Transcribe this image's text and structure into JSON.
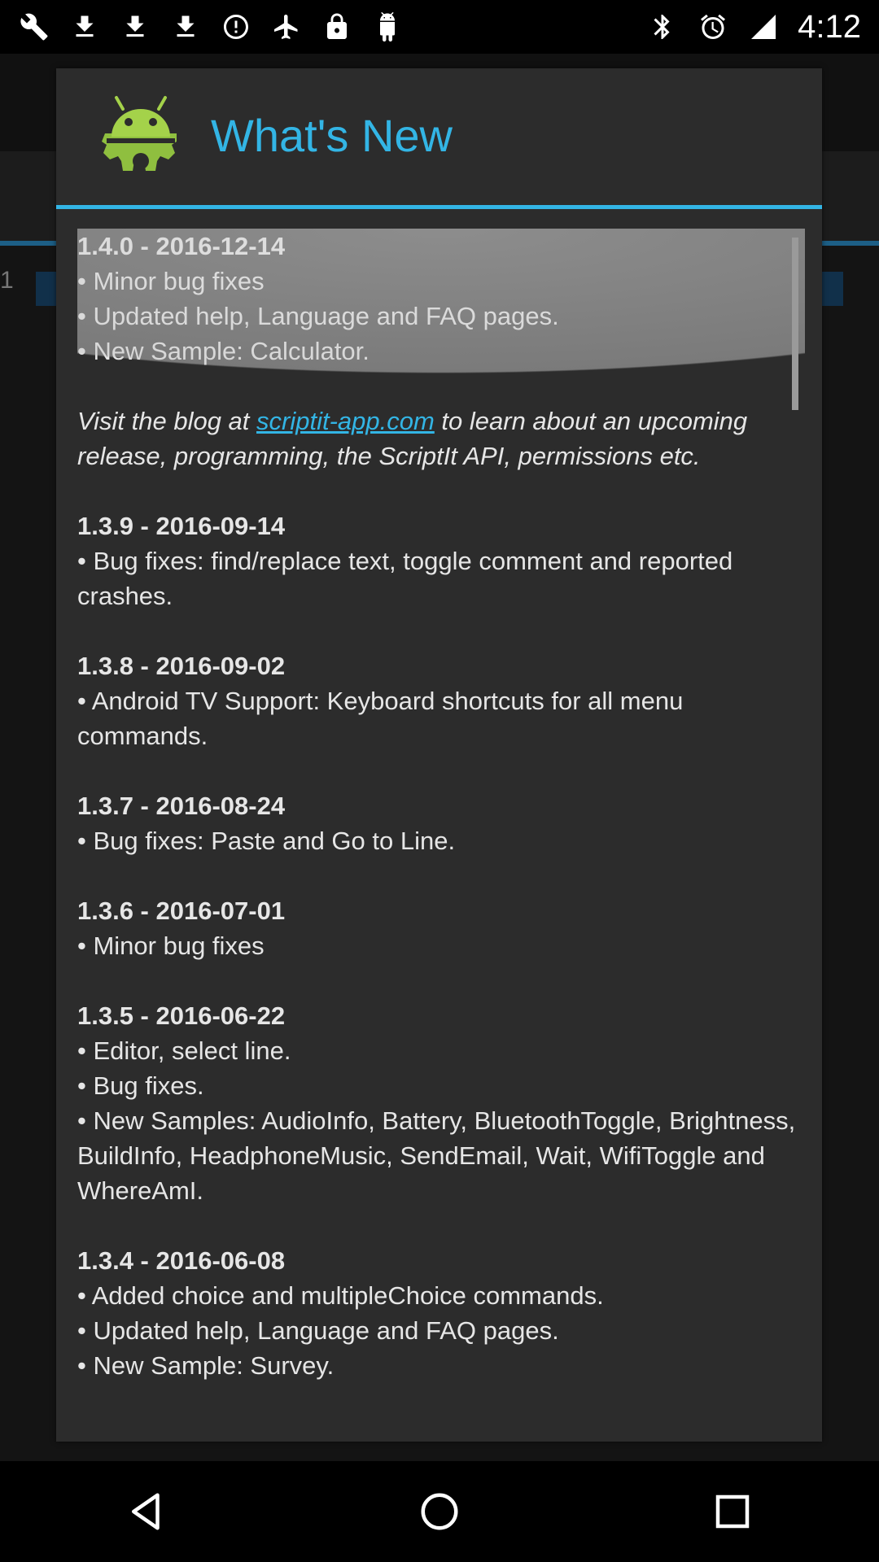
{
  "status_bar": {
    "left_icons": [
      "wrench-icon",
      "download-icon",
      "download-icon",
      "download-icon",
      "do-not-disturb-icon",
      "fake-gps-icon",
      "lock-icon",
      "android-icon"
    ],
    "right_icons": [
      "bluetooth-icon",
      "alarm-icon",
      "signal-icon"
    ],
    "time": "4:12"
  },
  "dialog": {
    "title": "What's New",
    "accent_color": "#33b5e5",
    "entries": [
      {
        "version": "1.4.0 - 2016-12-14",
        "bullets": [
          "•  Minor bug fixes",
          "•  Updated help, Language and FAQ pages.",
          "•  New Sample: Calculator."
        ]
      }
    ],
    "blog": {
      "prefix": "Visit the blog at ",
      "link": "scriptit-app.com",
      "suffix": " to learn about an upcoming release, programming, the ScriptIt API, permissions etc."
    },
    "more_entries": [
      {
        "version": "1.3.9 - 2016-09-14",
        "bullets": [
          "•  Bug fixes: find/replace text, toggle comment and reported crashes."
        ]
      },
      {
        "version": "1.3.8 - 2016-09-02",
        "bullets": [
          "•  Android TV Support: Keyboard shortcuts for all menu commands."
        ]
      },
      {
        "version": "1.3.7 - 2016-08-24",
        "bullets": [
          "•  Bug fixes: Paste and Go to Line."
        ]
      },
      {
        "version": "1.3.6 - 2016-07-01",
        "bullets": [
          "•  Minor bug fixes"
        ]
      },
      {
        "version": "1.3.5 - 2016-06-22",
        "bullets": [
          "•  Editor, select line.",
          "•  Bug fixes.",
          "•  New Samples: AudioInfo, Battery, BluetoothToggle, Brightness, BuildInfo, HeadphoneMusic, SendEmail, Wait, WifiToggle and WhereAmI."
        ]
      },
      {
        "version": "1.3.4 - 2016-06-08",
        "bullets": [
          "•  Added choice and multipleChoice commands.",
          "•  Updated help, Language and FAQ pages.",
          "•  New Sample: Survey."
        ]
      }
    ]
  },
  "background": {
    "row_number": "1"
  },
  "nav_bar": {
    "buttons": [
      "back-icon",
      "home-icon",
      "recents-icon"
    ]
  }
}
